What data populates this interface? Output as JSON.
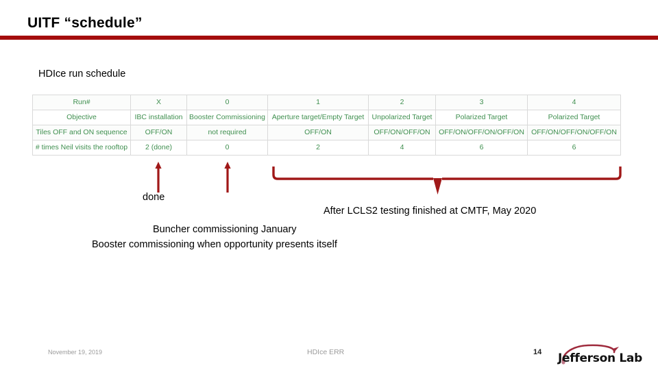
{
  "slide": {
    "title": "UITF “schedule”",
    "section_caption": "HDIce run schedule",
    "rule_color": "#a40d0d"
  },
  "table": {
    "text_color": "#3f8f4f",
    "rows": [
      {
        "label": "Run#",
        "cells": [
          "X",
          "0",
          "1",
          "2",
          "3",
          "4"
        ]
      },
      {
        "label": "Objective",
        "cells": [
          "IBC installation",
          "Booster Commissioning",
          "Aperture target/Empty Target",
          "Unpolarized Target",
          "Polarized Target",
          "Polarized Target"
        ]
      },
      {
        "label": "Tiles OFF and ON sequence",
        "cells": [
          "OFF/ON",
          "not required",
          "OFF/ON",
          "OFF/ON/OFF/ON",
          "OFF/ON/OFF/ON/OFF/ON",
          "OFF/ON/OFF/ON/OFF/ON"
        ]
      },
      {
        "label": "# times Neil visits the rooftop",
        "cells": [
          "2 (done)",
          "0",
          "2",
          "4",
          "6",
          "6"
        ]
      }
    ]
  },
  "annotations": {
    "color": "#a01818",
    "done": "done",
    "lcls2": "After LCLS2 testing finished at CMTF, May 2020",
    "buncher": "Buncher commissioning January",
    "booster": "Booster commissioning when opportunity presents itself"
  },
  "footer": {
    "date": "November 19, 2019",
    "center": "HDIce ERR",
    "page_number": "14",
    "logo_text": "Jefferson Lab",
    "logo_swoosh_color": "#9e2a3c"
  }
}
